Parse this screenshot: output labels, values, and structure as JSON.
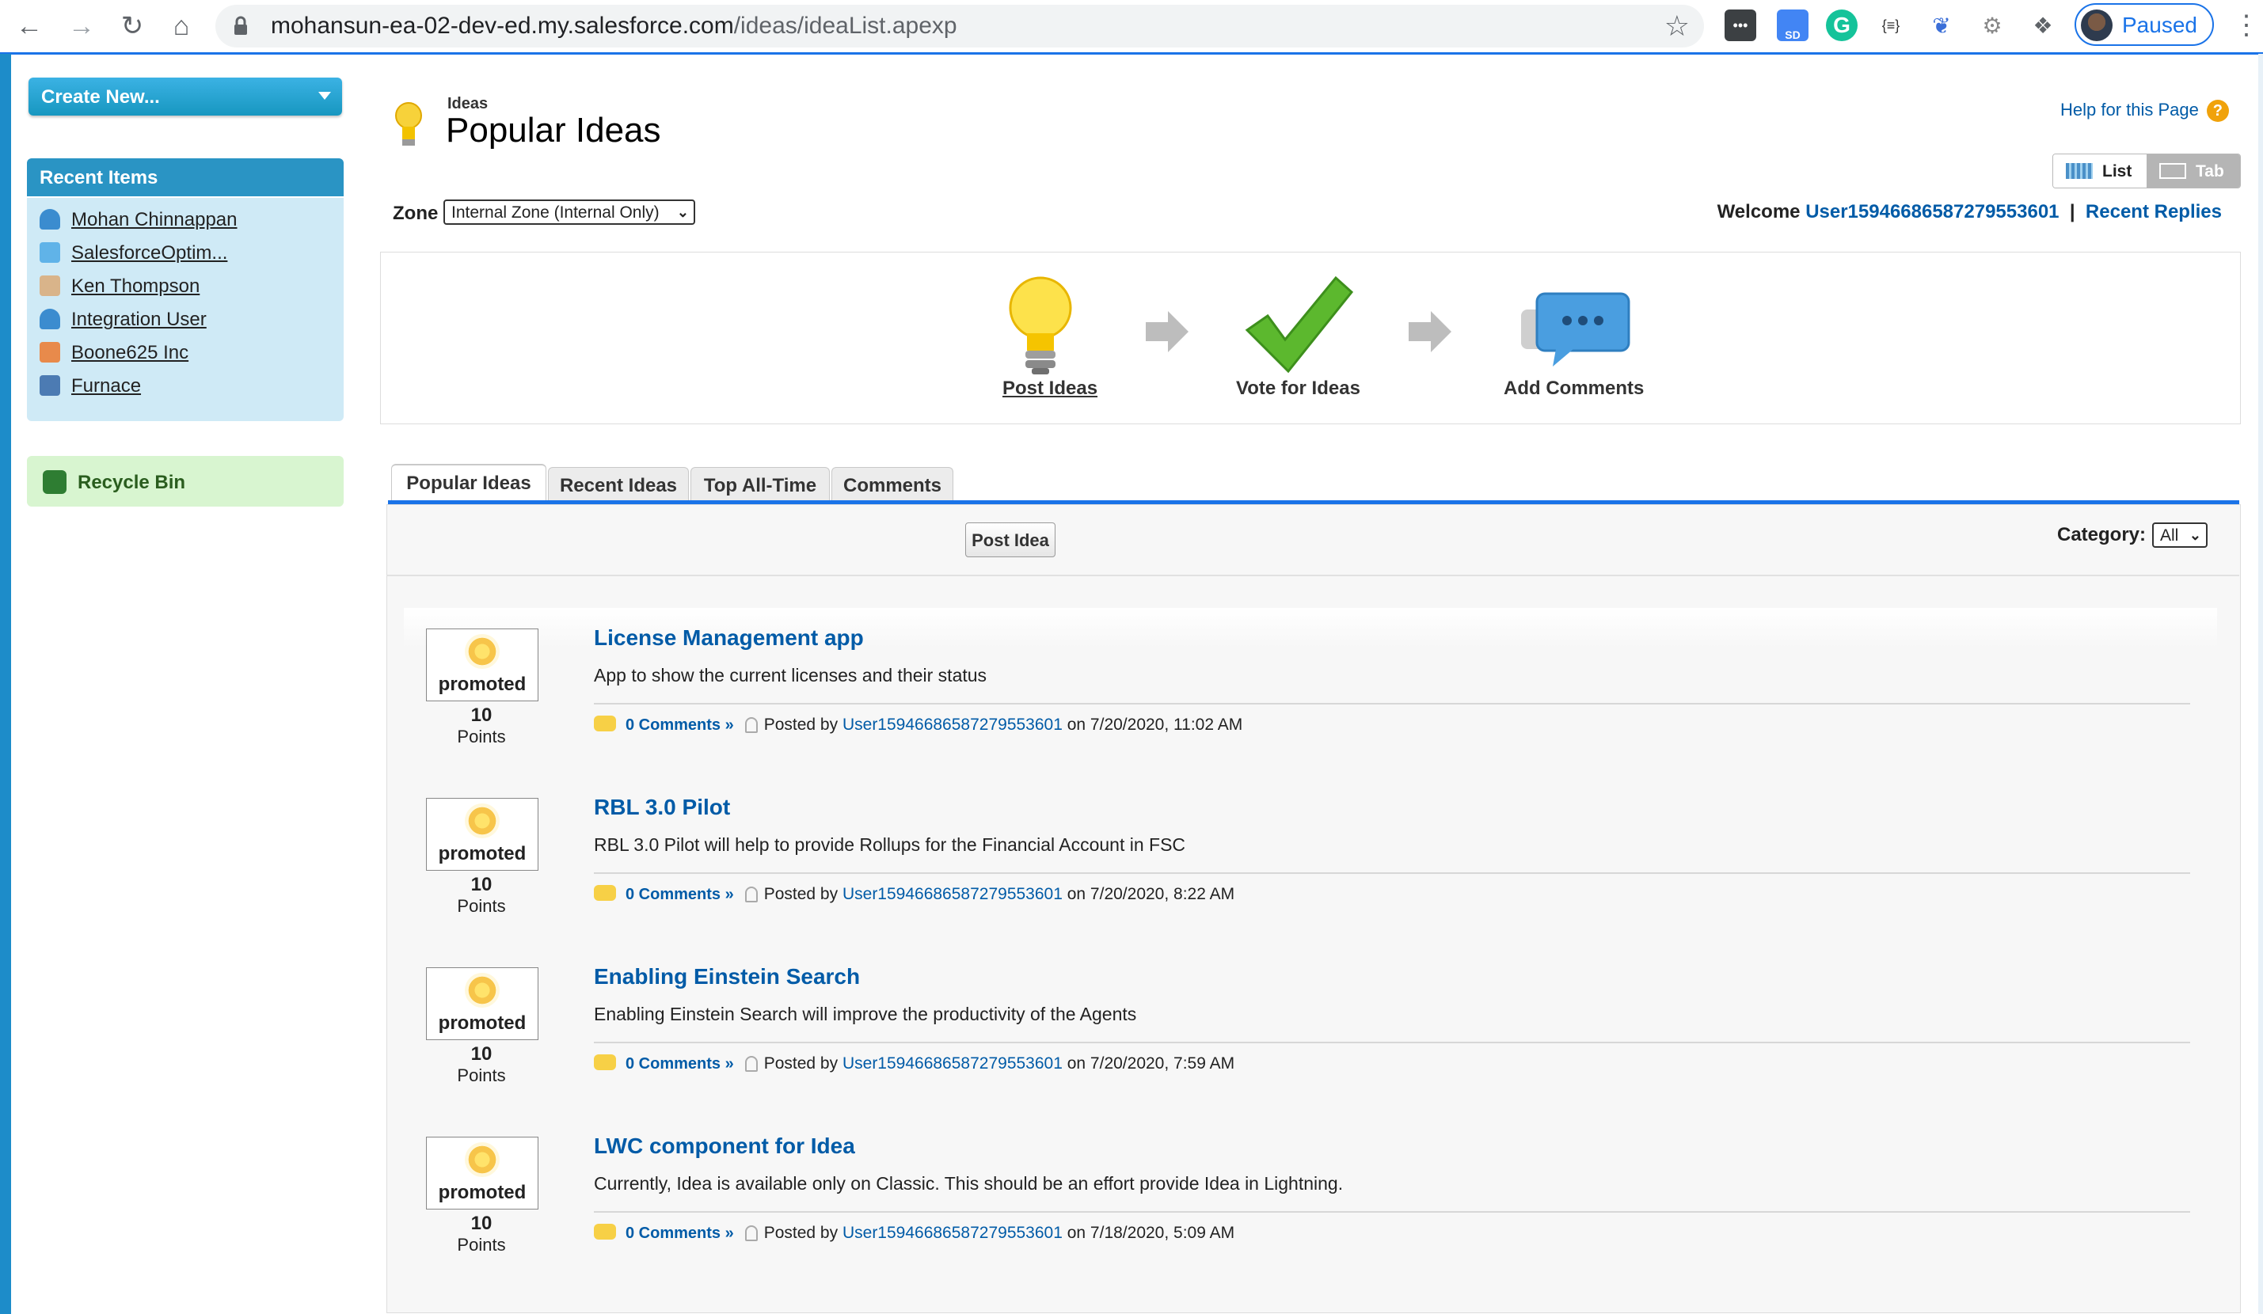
{
  "browser": {
    "url_host": "mohansun-ea-02-dev-ed.my.salesforce.com",
    "url_path": "/ideas/ideaList.apexp",
    "profile_label": "Paused",
    "ext_sd_badge": "SD",
    "ext_json_label": "{≡}"
  },
  "sidebar": {
    "create_new": "Create New...",
    "recent_items_title": "Recent Items",
    "recent_items": [
      {
        "label": "Mohan Chinnappan",
        "icon": "user-icon",
        "color": "#3b8ccf"
      },
      {
        "label": "SalesforceOptim...",
        "icon": "cloud-icon",
        "color": "#60b3e8"
      },
      {
        "label": "Ken Thompson",
        "icon": "contact-icon",
        "color": "#d9b48a"
      },
      {
        "label": "Integration User",
        "icon": "user-icon",
        "color": "#3b8ccf"
      },
      {
        "label": "Boone625 Inc",
        "icon": "account-icon",
        "color": "#e88a4b"
      },
      {
        "label": "Furnace",
        "icon": "asset-icon",
        "color": "#4c7bb3"
      }
    ],
    "recycle_bin": "Recycle Bin"
  },
  "header": {
    "breadcrumb": "Ideas",
    "title": "Popular Ideas",
    "help_link": "Help for this Page",
    "help_icon": "?",
    "view_list": "List",
    "view_tab": "Tab",
    "zone_label": "Zone",
    "zone_value": "Internal Zone (Internal Only)",
    "welcome_label": "Welcome",
    "welcome_user": "User15946686587279553601",
    "separator": "|",
    "recent_replies": "Recent Replies"
  },
  "steps": [
    {
      "label": "Post Ideas",
      "icon": "lightbulb-icon"
    },
    {
      "label": "Vote for Ideas",
      "icon": "checkmark-icon"
    },
    {
      "label": "Add Comments",
      "icon": "speech-bubble-icon"
    }
  ],
  "tabs": [
    "Popular Ideas",
    "Recent Ideas",
    "Top All-Time",
    "Comments"
  ],
  "toolbar": {
    "post_idea": "Post Idea",
    "category_label": "Category:",
    "category_value": "All"
  },
  "ideas": [
    {
      "status": "promoted",
      "points": "10",
      "points_label": "Points",
      "title": "License Management app",
      "body": "App to show the current licenses and their status",
      "comments": "0 Comments »",
      "posted_by": "Posted by",
      "user": "User15946686587279553601",
      "date": "on 7/20/2020, 11:02 AM"
    },
    {
      "status": "promoted",
      "points": "10",
      "points_label": "Points",
      "title": "RBL 3.0 Pilot",
      "body": "RBL 3.0 Pilot will help to provide Rollups for the Financial Account in FSC",
      "comments": "0 Comments »",
      "posted_by": "Posted by",
      "user": "User15946686587279553601",
      "date": "on 7/20/2020, 8:22 AM"
    },
    {
      "status": "promoted",
      "points": "10",
      "points_label": "Points",
      "title": "Enabling Einstein Search",
      "body": "Enabling Einstein Search will improve the productivity of the Agents",
      "comments": "0 Comments »",
      "posted_by": "Posted by",
      "user": "User15946686587279553601",
      "date": "on 7/20/2020, 7:59 AM"
    },
    {
      "status": "promoted",
      "points": "10",
      "points_label": "Points",
      "title": "LWC component for Idea",
      "body": "Currently, Idea is available only on Classic. This should be an effort provide Idea in Lightning.",
      "comments": "0 Comments »",
      "posted_by": "Posted by",
      "user": "User15946686587279553601",
      "date": "on 7/18/2020, 5:09 AM"
    }
  ]
}
